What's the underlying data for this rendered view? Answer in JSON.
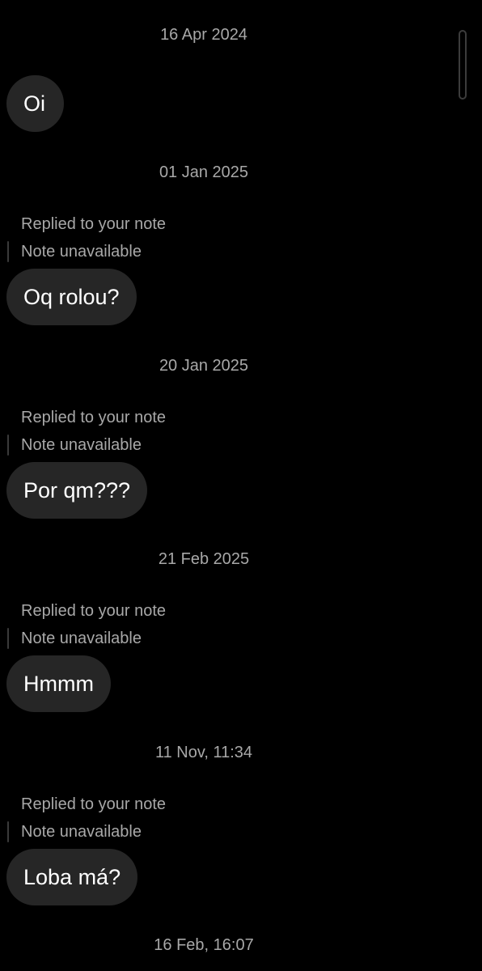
{
  "messages": [
    {
      "date": "16 Apr 2024",
      "reply_label": "",
      "note": "",
      "text": "Oi"
    },
    {
      "date": "01 Jan 2025",
      "reply_label": "Replied to your note",
      "note": "Note unavailable",
      "text": "Oq rolou?"
    },
    {
      "date": "20 Jan 2025",
      "reply_label": "Replied to your note",
      "note": "Note unavailable",
      "text": "Por qm???"
    },
    {
      "date": "21 Feb 2025",
      "reply_label": "Replied to your note",
      "note": "Note unavailable",
      "text": "Hmmm"
    },
    {
      "date": "11 Nov, 11:34",
      "reply_label": "Replied to your note",
      "note": "Note unavailable",
      "text": "Loba má?"
    },
    {
      "date": "16 Feb, 16:07"
    }
  ],
  "colors": {
    "background": "#000000",
    "bubble": "#262626",
    "meta_text": "#a8a8a8"
  }
}
